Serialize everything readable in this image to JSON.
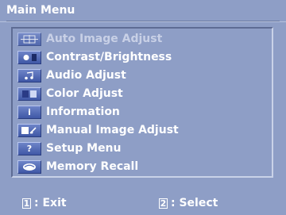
{
  "title": "Main Menu",
  "menu": {
    "items": [
      {
        "label": "Auto Image Adjust",
        "icon": "auto-adjust-icon"
      },
      {
        "label": "Contrast/Brightness",
        "icon": "contrast-brightness-icon"
      },
      {
        "label": "Audio Adjust",
        "icon": "audio-icon"
      },
      {
        "label": "Color Adjust",
        "icon": "color-icon"
      },
      {
        "label": "Information",
        "icon": "info-icon",
        "glyph": "i"
      },
      {
        "label": "Manual Image Adjust",
        "icon": "manual-adjust-icon"
      },
      {
        "label": "Setup Menu",
        "icon": "help-icon",
        "glyph": "?"
      },
      {
        "label": "Memory Recall",
        "icon": "memory-recall-icon"
      }
    ]
  },
  "footer": {
    "exit_key": "1",
    "exit_label": ": Exit",
    "select_key": "2",
    "select_label": ": Select"
  },
  "colors": {
    "background": "#8e9ec6",
    "icon": "#4f68b6",
    "text": "#ffffff",
    "disabled_text": "#c8d0e6"
  }
}
